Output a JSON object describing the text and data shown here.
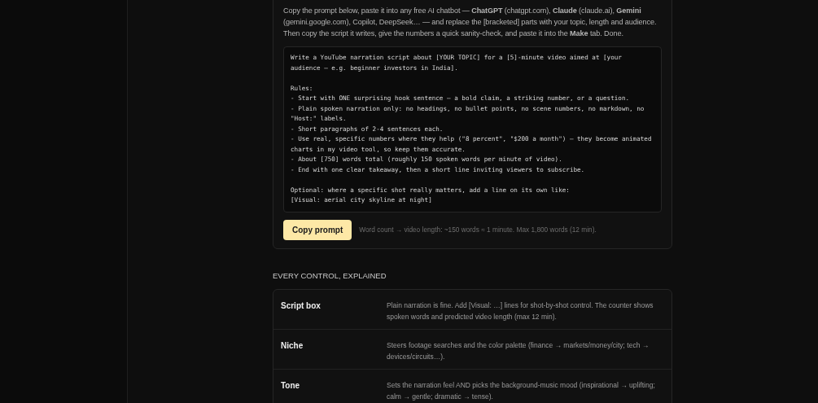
{
  "intro": "Copy the prompt below, paste it into any free AI chatbot — **ChatGPT** (chatgpt.com), **Claude** (claude.ai), **Gemini** (gemini.google.com), Copilot, DeepSeek… — and replace the [bracketed] parts with your topic, length and audience. Then copy the script it writes, give the numbers a quick sanity-check, and paste it into the **Make** tab. Done.",
  "prompt_blocks": [
    [
      "Write a YouTube narration script about [YOUR TOPIC] for a [5]-minute video aimed at [your",
      "audience — e.g. beginner investors in India]."
    ],
    [
      "Rules:",
      "- Start with ONE surprising hook sentence — a bold claim, a striking number, or a question.",
      "- Plain spoken narration only: no headings, no bullet points, no scene numbers, no markdown, no",
      "\"Host:\" labels.",
      "- Short paragraphs of 2-4 sentences each.",
      "- Use real, specific numbers where they help (\"8 percent\", \"$200 a month\") — they become animated",
      "charts in my video tool, so keep them accurate.",
      "- About [750] words total (roughly 150 spoken words per minute of video).",
      "- End with one clear takeaway, then a short line inviting viewers to subscribe."
    ],
    [
      "Optional: where a specific shot really matters, add a line on its own like:",
      "[Visual: aerial city skyline at night]"
    ]
  ],
  "copy_button": "Copy prompt",
  "hint": "Word count → video length: ~150 words ≈ 1 minute. Max 1,800 words (12 min).",
  "section_title": "EVERY CONTROL, EXPLAINED",
  "controls": [
    {
      "name": "Script box",
      "description": "Plain narration is fine. Add [Visual: …] lines for shot-by-shot control. The counter shows spoken words and predicted video length (max 12 min)."
    },
    {
      "name": "Niche",
      "description": "Steers footage searches and the color palette (finance → markets/money/city; tech → devices/circuits…)."
    },
    {
      "name": "Tone",
      "description": "Sets the narration feel AND picks the background-music mood (inspirational → uplifting; calm → gentle; dramatic → tense)."
    }
  ]
}
